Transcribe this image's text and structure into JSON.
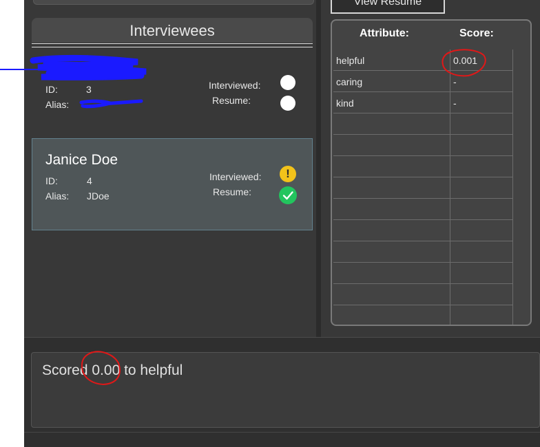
{
  "toolbar": {
    "view_resume_label": "View Resume"
  },
  "interviewees": {
    "title": "Interviewees",
    "field_labels": {
      "id": "ID:",
      "alias": "Alias:",
      "interviewed": "Interviewed:",
      "resume": "Resume:"
    },
    "items": [
      {
        "name": "",
        "id": "3",
        "alias": "",
        "interviewed_status": "none",
        "resume_status": "none"
      },
      {
        "name": "Janice Doe",
        "id": "4",
        "alias": "JDoe",
        "interviewed_status": "warning",
        "resume_status": "ok"
      }
    ]
  },
  "attributes": {
    "headers": {
      "attribute": "Attribute:",
      "score": "Score:"
    },
    "rows": [
      {
        "attribute": "helpful",
        "score": "0.001"
      },
      {
        "attribute": "caring",
        "score": "-"
      },
      {
        "attribute": "kind",
        "score": "-"
      }
    ],
    "empty_row_count": 10
  },
  "output": {
    "message": "Scored 0.00 to helpful"
  },
  "colors": {
    "background": "#383838",
    "card_selected": "#4f5658",
    "warning": "#f2c21a",
    "ok": "#22c55e",
    "annotation_red": "#e01818",
    "redaction_blue": "#1a1aff"
  },
  "icons": {
    "warning": "exclamation-icon",
    "ok": "checkmark-icon"
  }
}
